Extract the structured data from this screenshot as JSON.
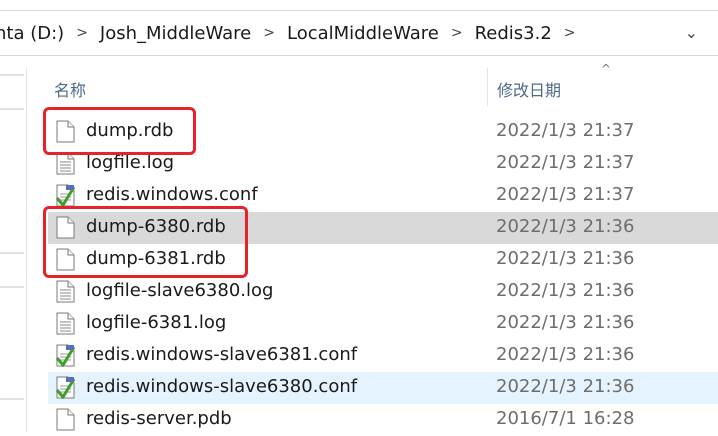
{
  "address_bar": {
    "crumbs": [
      "nta (D:)",
      "Josh_MiddleWare",
      "LocalMiddleWare",
      "Redis3.2"
    ],
    "separator": ">",
    "dropdown_glyph": "⌄"
  },
  "columns": {
    "name": "名称",
    "date_modified": "修改日期",
    "sort_glyph": "^"
  },
  "files": [
    {
      "name": "dump.rdb",
      "date": "2022/1/3 21:37",
      "icon": "blank-file-icon",
      "state": "normal"
    },
    {
      "name": "logfile.log",
      "date": "2022/1/3 21:37",
      "icon": "text-file-icon",
      "state": "normal"
    },
    {
      "name": "redis.windows.conf",
      "date": "2022/1/3 21:37",
      "icon": "conf-file-icon",
      "state": "normal"
    },
    {
      "name": "dump-6380.rdb",
      "date": "2022/1/3 21:36",
      "icon": "blank-file-icon",
      "state": "selected"
    },
    {
      "name": "dump-6381.rdb",
      "date": "2022/1/3 21:36",
      "icon": "blank-file-icon",
      "state": "normal"
    },
    {
      "name": "logfile-slave6380.log",
      "date": "2022/1/3 21:36",
      "icon": "text-file-icon",
      "state": "normal"
    },
    {
      "name": "logfile-6381.log",
      "date": "2022/1/3 21:36",
      "icon": "text-file-icon",
      "state": "normal"
    },
    {
      "name": "redis.windows-slave6381.conf",
      "date": "2022/1/3 21:36",
      "icon": "conf-file-icon",
      "state": "normal"
    },
    {
      "name": "redis.windows-slave6380.conf",
      "date": "2022/1/3 21:36",
      "icon": "conf-file-icon",
      "state": "hover"
    },
    {
      "name": "redis-server.pdb",
      "date": "2016/7/1 16:28",
      "icon": "blank-file-icon",
      "state": "normal"
    }
  ],
  "colors": {
    "highlight_box": "#e8222b",
    "selected_row": "#d9d9d9",
    "hover_row": "#e5f3ff",
    "header_text": "#4d6a88"
  }
}
